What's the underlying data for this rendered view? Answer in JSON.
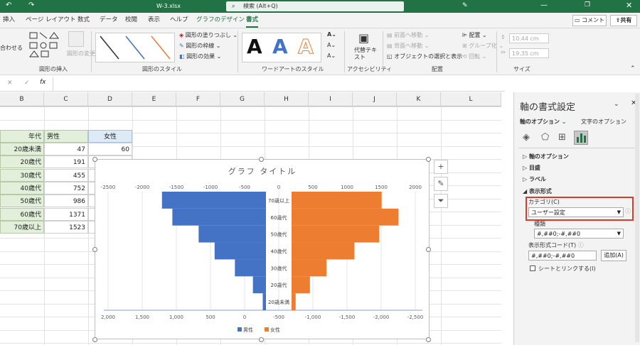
{
  "titlebar": {
    "filename": "W-3.xlsx",
    "search_placeholder": "検索 (Alt+Q)"
  },
  "tabs": [
    "挿入",
    "ページ レイアウト",
    "数式",
    "データ",
    "校閲",
    "表示",
    "ヘルプ",
    "グラフのデザイン",
    "書式"
  ],
  "header": {
    "comment": "コメント",
    "share": "共有"
  },
  "ribbon": {
    "insert_shapes_label": "図形の挿入",
    "shape_styles_label": "図形のスタイル",
    "wordart_label": "ワードアートのスタイル",
    "accessibility_label": "アクセシビリティ",
    "arrange_label": "配置",
    "size_label": "サイズ",
    "fill": "図形の塗りつぶし",
    "outline": "図形の枠線",
    "effects": "図形の効果",
    "change_shape": "図形の変更",
    "alt_text": "代替テキスト",
    "bring_forward": "前面へ移動",
    "send_backward": "背面へ移動",
    "selection_pane": "オブジェクトの選択と表示",
    "align": "配置",
    "group": "グループ化",
    "rotate": "回転",
    "height": "10.44 cm",
    "width": "19.35 cm",
    "merge": "合わせる",
    "wordart_letter": "A"
  },
  "columns": [
    "B",
    "C",
    "D",
    "E",
    "F",
    "G",
    "H",
    "I",
    "J",
    "K",
    "L"
  ],
  "table": {
    "headers": [
      "年代",
      "男性",
      "女性"
    ],
    "rows": [
      {
        "label": "20歳未満",
        "male": "47",
        "female": "60"
      },
      {
        "label": "20歳代",
        "male": "191",
        "female": "269"
      },
      {
        "label": "30歳代",
        "male": "455",
        "female": ""
      },
      {
        "label": "40歳代",
        "male": "752",
        "female": ""
      },
      {
        "label": "50歳代",
        "male": "986",
        "female": ""
      },
      {
        "label": "60歳代",
        "male": "1371",
        "female": ""
      },
      {
        "label": "70歳以上",
        "male": "1523",
        "female": ""
      }
    ]
  },
  "chart_data": {
    "type": "bar",
    "title": "グラフ タイトル",
    "categories": [
      "20歳未満",
      "20歳代",
      "30歳代",
      "40歳代",
      "50歳代",
      "60歳代",
      "70歳以上"
    ],
    "series": [
      {
        "name": "男性",
        "values": [
          47,
          191,
          455,
          752,
          986,
          1371,
          1523
        ],
        "color": "#4472c4"
      },
      {
        "name": "女性",
        "values": [
          60,
          269,
          512,
          921,
          1284,
          1567,
          1320
        ],
        "color": "#ed7d31"
      }
    ],
    "top_ticks": [
      "-2500",
      "-2000",
      "-1500",
      "-1000",
      "-500",
      "0",
      "500",
      "1000",
      "1500",
      "2000"
    ],
    "bottom_ticks": [
      "2,000",
      "1,500",
      "1,000",
      "500",
      "0",
      "-500",
      "-1,000",
      "-1,500",
      "-2,000",
      "-2,500"
    ],
    "y_tick_labels": [
      "70歳以上",
      "60歳代",
      "50歳代",
      "40歳代",
      "30歳代",
      "20歳代",
      "20歳未満"
    ],
    "xlim": [
      -2500,
      2000
    ],
    "legend": "bottom"
  },
  "panel": {
    "title": "軸の書式設定",
    "tab_axis": "軸のオプション",
    "tab_text": "文字のオプション",
    "sections": [
      "軸のオプション",
      "目盛",
      "ラベル",
      "表示形式"
    ],
    "category_label": "カテゴリ(C)",
    "category_value": "ユーザー設定",
    "type_label": "種類",
    "type_value": "#,##0;-#,##0",
    "format_code_label": "表示形式コード(T)",
    "format_code_value": "#,##0;-#,##0",
    "add_button": "追加(A)",
    "link_label": "シートとリンクする(I)"
  }
}
